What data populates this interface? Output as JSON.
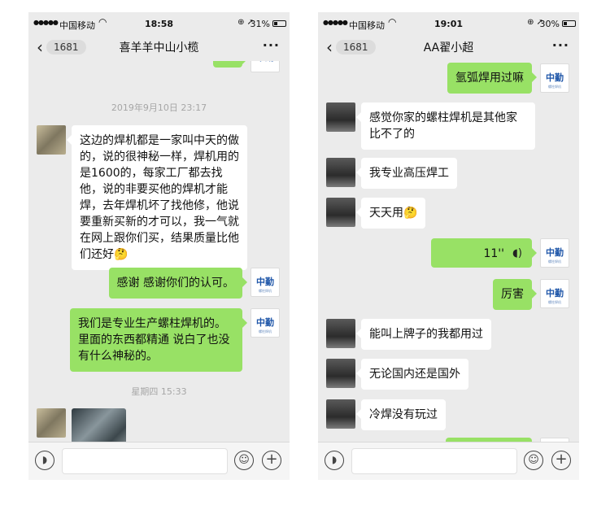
{
  "left": {
    "status": {
      "carrier": "中国移动",
      "time": "18:58",
      "battery_pct": "31%"
    },
    "nav": {
      "back_count": "1681",
      "title": "喜羊羊中山小榄"
    },
    "timestamps": [
      "2019年9月10日 23:17",
      "星期四 15:33"
    ],
    "messages": [
      "这边的焊机都是一家叫中天的做的，说的很神秘一样，焊机用的是1600的，每家工厂都去找他，说的非要买他的焊机才能焊，去年焊机坏了找他修，他说要重新买新的才可以，我一气就在网上跟你们买，结果质量比他们还好🤔",
      "感谢 感谢你们的认可。",
      "我们是专业生产螺柱焊机的。里面的东西都精通 说白了也没有什么神秘的。"
    ]
  },
  "right": {
    "status": {
      "carrier": "中国移动",
      "time": "19:01",
      "battery_pct": "30%"
    },
    "nav": {
      "back_count": "1681",
      "title": "AA翟小超"
    },
    "messages": [
      "氩弧焊用过嘛",
      "感觉你家的螺柱焊机是其他家比不了的",
      "我专业高压焊工",
      "天天用🤔",
      "11''",
      "厉害",
      "能叫上牌子的我都用过",
      "无论国内还是国外",
      "冷焊没有玩过"
    ]
  },
  "brand_avatar": {
    "logo": "中勤",
    "sub": "螺柱焊机"
  },
  "icons": {
    "back": "chevron-left-icon",
    "more": "more-dots-icon",
    "voice": "voice-input-icon",
    "emoji": "emoji-icon",
    "plus": "plus-icon",
    "wifi": "wifi-icon",
    "voice_wave": "voice-wave-icon"
  },
  "colors": {
    "outgoing_bubble": "#98e165",
    "incoming_bubble": "#ffffff",
    "chat_bg": "#ebebeb"
  }
}
